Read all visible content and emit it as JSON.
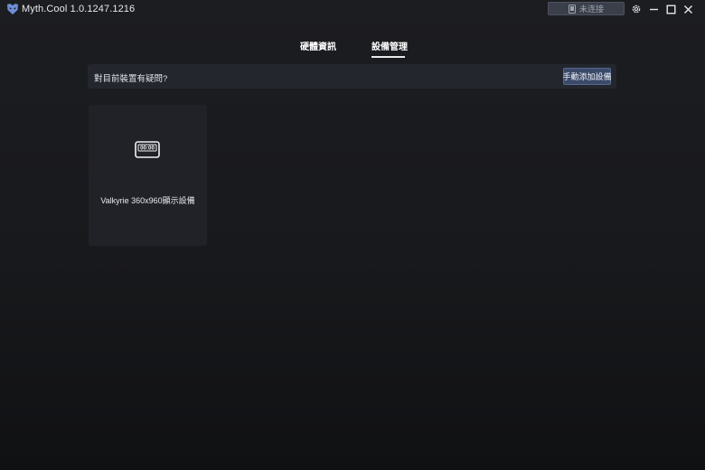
{
  "titlebar": {
    "app_title": "Myth.Cool  1.0.1247.1216",
    "connection_status": "未连接",
    "icons": [
      "myth-cool-logo-icon",
      "display-device-icon",
      "settings-gear-icon",
      "minimize-icon",
      "maximize-icon",
      "close-icon"
    ]
  },
  "tabs": [
    {
      "label": "硬體資訊",
      "active": false
    },
    {
      "label": "設備管理",
      "active": true
    }
  ],
  "help_bar": {
    "question": "對目前裝置有疑問?",
    "add_button_label": "手動添加設備"
  },
  "devices": [
    {
      "name": "Valkyrie 360x960顯示設備",
      "icon": "lcd-screen-icon",
      "icon_text": "00:00"
    }
  ],
  "colors": {
    "background": "#1c1d21",
    "card": "#202227",
    "accent_button": "#3c4a6a",
    "status_pill": "#3a3f4a"
  }
}
